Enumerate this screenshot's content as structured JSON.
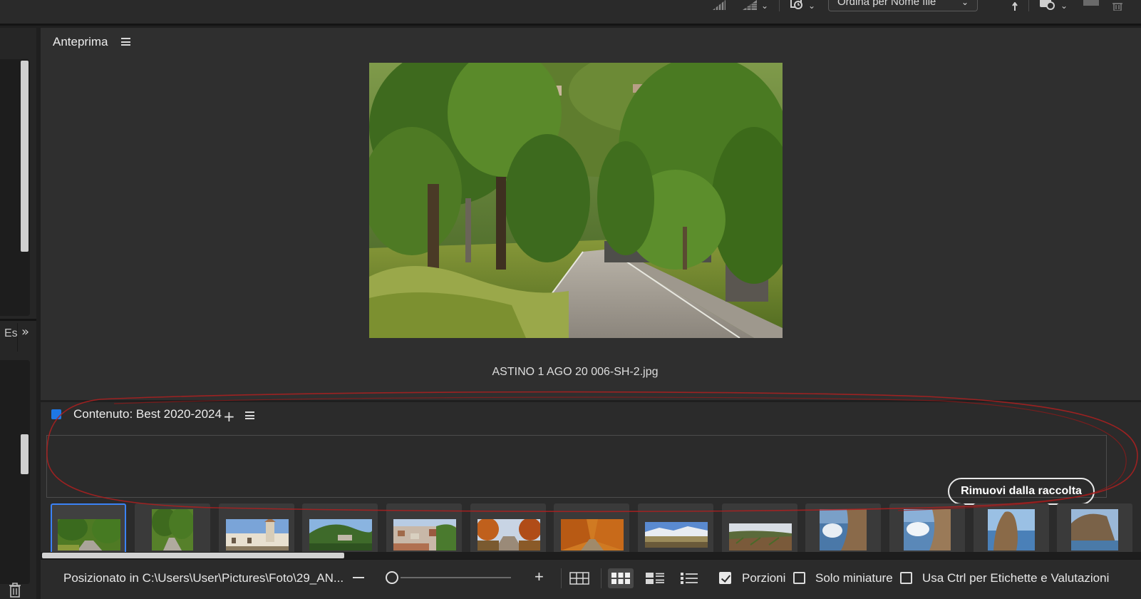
{
  "toolbar": {
    "sort_label": "Ordina per Nome file",
    "icons": [
      "filter-stars-icon",
      "filter-grid-icon",
      "filter-time-icon",
      "sort-direction-icon",
      "camera-time-icon",
      "window-icon",
      "trash-icon"
    ]
  },
  "left_panel": {
    "tab_label": "Es"
  },
  "preview": {
    "title": "Anteprima",
    "filename": "ASTINO 1 AGO 20 006-SH-2.jpg"
  },
  "content": {
    "title": "Contenuto: Best 2020-2024",
    "remove_button": "Rimuovi dalla raccolta",
    "thumbnails": [
      {
        "scene": "tree-road",
        "selected": true
      },
      {
        "scene": "tree-road-portrait",
        "selected": false
      },
      {
        "scene": "church",
        "selected": false
      },
      {
        "scene": "hills",
        "selected": false
      },
      {
        "scene": "town",
        "selected": false
      },
      {
        "scene": "autumn-path",
        "selected": false
      },
      {
        "scene": "autumn-avenue",
        "selected": false
      },
      {
        "scene": "mountains-field",
        "selected": false
      },
      {
        "scene": "vineyard",
        "selected": false
      },
      {
        "scene": "sea-cliff",
        "selected": false
      },
      {
        "scene": "sea-cliff-2",
        "selected": false
      },
      {
        "scene": "rock-sea",
        "selected": false
      },
      {
        "scene": "cliff-partial",
        "selected": false
      }
    ]
  },
  "status": {
    "path": "Posizionato in C:\\Users\\User\\Pictures\\Foto\\29_AN...",
    "porzioni_label": "Porzioni",
    "porzioni_checked": true,
    "solo_miniature_label": "Solo miniature",
    "solo_miniature_checked": false,
    "ctrl_label": "Usa Ctrl per Etichette e Valutazioni",
    "ctrl_checked": false,
    "active_view": "grid-thumbnails"
  },
  "colors": {
    "accent": "#1e78e6",
    "annotation": "#b02020",
    "selection": "#3b82f6"
  }
}
